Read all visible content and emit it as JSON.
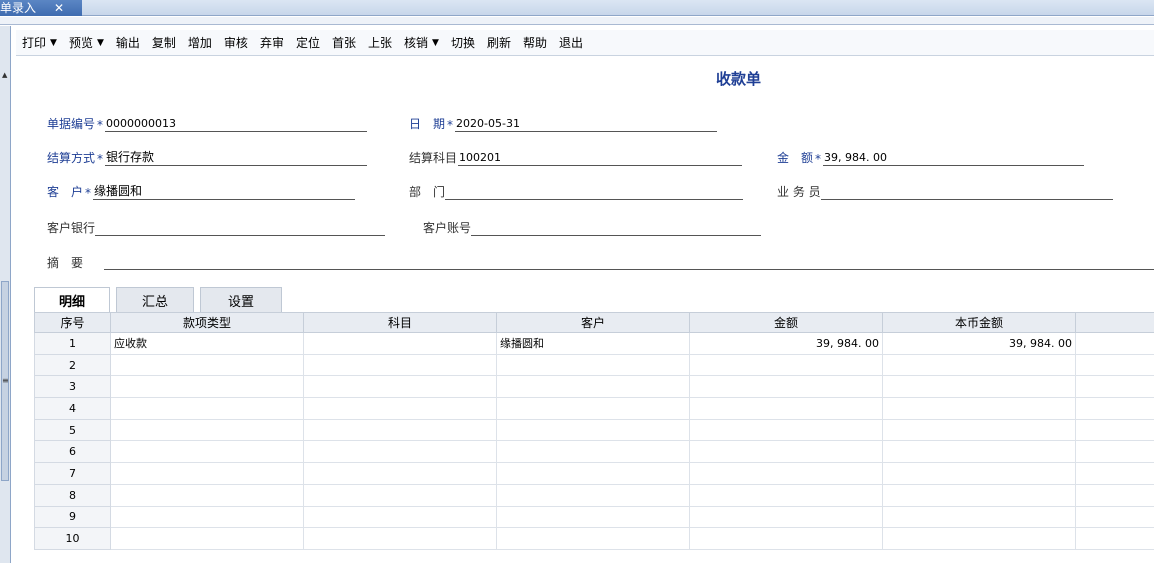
{
  "tab": {
    "title": "单录入",
    "close": "✕"
  },
  "toolbar": [
    {
      "label": "打印",
      "caret": true
    },
    {
      "label": "预览",
      "caret": true
    },
    {
      "label": "输出",
      "caret": false
    },
    {
      "label": "复制",
      "caret": false
    },
    {
      "label": "增加",
      "caret": false
    },
    {
      "label": "审核",
      "caret": false
    },
    {
      "label": "弃审",
      "caret": false
    },
    {
      "label": "定位",
      "caret": false
    },
    {
      "label": "首张",
      "caret": false
    },
    {
      "label": "上张",
      "caret": false
    },
    {
      "label": "核销",
      "caret": true
    },
    {
      "label": "切换",
      "caret": false
    },
    {
      "label": "刷新",
      "caret": false
    },
    {
      "label": "帮助",
      "caret": false
    },
    {
      "label": "退出",
      "caret": false
    }
  ],
  "form": {
    "title": "收款单",
    "bill_no": {
      "label": "单据编号",
      "value": "0000000013"
    },
    "date": {
      "label": "日　期",
      "value": "2020-05-31"
    },
    "settle_method": {
      "label": "结算方式",
      "value": "银行存款"
    },
    "settle_account": {
      "label": "结算科目",
      "value": "100201"
    },
    "amount": {
      "label": "金　额",
      "value": "39, 984. 00"
    },
    "customer": {
      "label": "客　户",
      "value": "缘播圆和"
    },
    "department": {
      "label": "部　门",
      "value": ""
    },
    "salesman": {
      "label": "业 务 员",
      "value": ""
    },
    "customer_bank": {
      "label": "客户银行",
      "value": ""
    },
    "customer_account": {
      "label": "客户账号",
      "value": ""
    },
    "remarks": {
      "label": "摘　要",
      "value": ""
    }
  },
  "subtabs": [
    "明细",
    "汇总",
    "设置"
  ],
  "grid": {
    "headers": [
      "序号",
      "款项类型",
      "科目",
      "客户",
      "金额",
      "本币金额",
      ""
    ],
    "rows": [
      [
        "1",
        "应收款",
        "",
        "缘播圆和",
        "39, 984. 00",
        "39, 984. 00",
        ""
      ],
      [
        "2",
        "",
        "",
        "",
        "",
        "",
        ""
      ],
      [
        "3",
        "",
        "",
        "",
        "",
        "",
        ""
      ],
      [
        "4",
        "",
        "",
        "",
        "",
        "",
        ""
      ],
      [
        "5",
        "",
        "",
        "",
        "",
        "",
        ""
      ],
      [
        "6",
        "",
        "",
        "",
        "",
        "",
        ""
      ],
      [
        "7",
        "",
        "",
        "",
        "",
        "",
        ""
      ],
      [
        "8",
        "",
        "",
        "",
        "",
        "",
        ""
      ],
      [
        "9",
        "",
        "",
        "",
        "",
        "",
        ""
      ],
      [
        "10",
        "",
        "",
        "",
        "",
        "",
        ""
      ]
    ]
  },
  "colors": {
    "label_blue": "#1f3f95",
    "tab_blue": "#3f6cb0"
  }
}
